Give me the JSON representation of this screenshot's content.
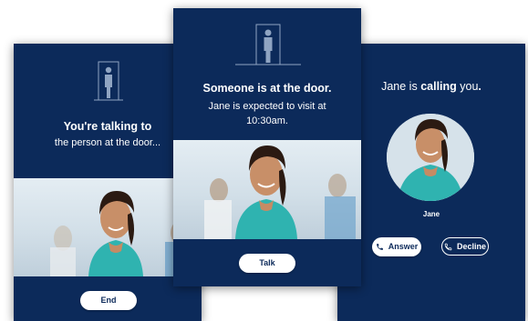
{
  "left_screen": {
    "title": "You're talking to",
    "subtitle": "the person at the door...",
    "end_label": "End"
  },
  "middle_screen": {
    "title": "Someone is at the door.",
    "message_line1": "Jane is expected to visit at",
    "message_line2": "10:30am.",
    "talk_label": "Talk"
  },
  "right_screen": {
    "caller_name": "Jane",
    "text_before": "Jane is ",
    "text_bold": "calling",
    "text_after": " you",
    "text_end": ".",
    "caller_label": "Jane",
    "answer_label": "Answer",
    "decline_label": "Decline"
  },
  "colors": {
    "card_background": "#0c2a5a",
    "button_background": "#ffffff",
    "scrub_color": "#2fb3b0"
  },
  "icons": [
    "door-person-icon",
    "phone-answer-icon",
    "phone-decline-icon"
  ]
}
